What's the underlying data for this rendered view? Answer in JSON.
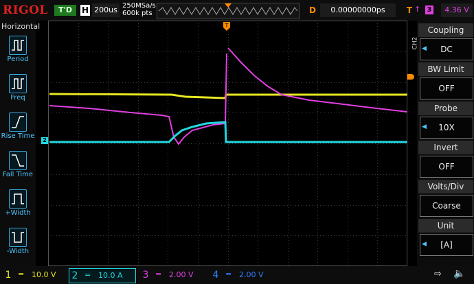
{
  "brand": "RIGOL",
  "top": {
    "run_state": "T'D",
    "horizontal_letter": "H",
    "timebase": "200us",
    "sample_rate": "250MSa/s",
    "memory_depth": "600k pts",
    "delay_letter": "D",
    "delay_value": "0.00000000ps",
    "trigger_letter": "T",
    "trigger_edge": "↑",
    "trigger_source": "3",
    "trigger_level": "4.36 V"
  },
  "left_menu": {
    "title": "Horizontal",
    "items": [
      {
        "label": "Period",
        "icon": "period-icon"
      },
      {
        "label": "Freq",
        "icon": "freq-icon"
      },
      {
        "label": "Rise Time",
        "icon": "rise-time-icon"
      },
      {
        "label": "Fall Time",
        "icon": "fall-time-icon"
      },
      {
        "label": "+Width",
        "icon": "positive-width-icon"
      },
      {
        "label": "-Width",
        "icon": "negative-width-icon"
      }
    ]
  },
  "right_menu": {
    "channel_label": "CH2",
    "items": [
      {
        "title": "Coupling",
        "value": "DC"
      },
      {
        "title": "BW Limit",
        "value": "OFF"
      },
      {
        "title": "Probe",
        "value": "10X"
      },
      {
        "title": "Invert",
        "value": "OFF"
      },
      {
        "title": "Volts/Div",
        "value": "Coarse"
      },
      {
        "title": "Unit",
        "value": "[A]"
      }
    ]
  },
  "channels": [
    {
      "num": "1",
      "coupling": "=",
      "scale": "10.0 V",
      "color": "#e8e820"
    },
    {
      "num": "2",
      "coupling": "=",
      "scale": "10.0 A",
      "color": "#22d8e0"
    },
    {
      "num": "3",
      "coupling": "=",
      "scale": "2.00 V",
      "color": "#e040e0"
    },
    {
      "num": "4",
      "coupling": "=",
      "scale": "2.00 V",
      "color": "#2f7fff"
    }
  ],
  "markers": {
    "ch2_ground": "2",
    "trigger_pos": "T"
  },
  "colors": {
    "accent": "#4cc6ff",
    "trigger": "#ff8a00",
    "grid": "#3a3a3a"
  }
}
